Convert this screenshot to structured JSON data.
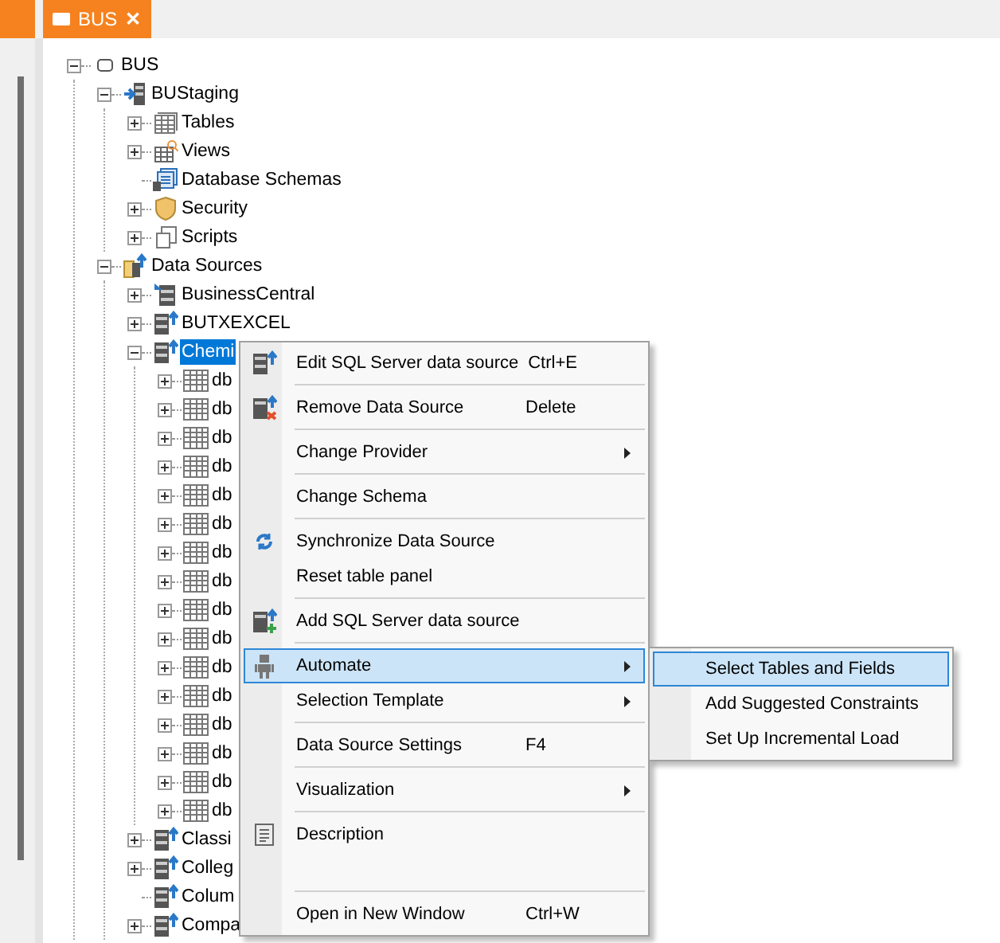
{
  "tabs": [
    {
      "label": "BUS",
      "close_glyph": "✕",
      "selected": true
    }
  ],
  "tree": [
    {
      "label": "BUS",
      "kind": "model",
      "expanded": true,
      "selected": false,
      "children": [
        {
          "label": "BUStaging",
          "kind": "staging",
          "expanded": true,
          "selected": false,
          "children": [
            {
              "label": "Tables",
              "kind": "tables",
              "expanded": false,
              "selected": false
            },
            {
              "label": "Views",
              "kind": "views",
              "expanded": false,
              "selected": false
            },
            {
              "label": "Database Schemas",
              "kind": "schemas",
              "selected": false
            },
            {
              "label": "Security",
              "kind": "security",
              "expanded": false,
              "selected": false
            },
            {
              "label": "Scripts",
              "kind": "scripts",
              "expanded": false,
              "selected": false
            }
          ]
        },
        {
          "label": "Data Sources",
          "kind": "datasources",
          "expanded": true,
          "selected": false,
          "children": [
            {
              "label": "BusinessCentral",
              "kind": "source-in",
              "expanded": false,
              "selected": false
            },
            {
              "label": "BUTXEXCEL",
              "kind": "source",
              "expanded": false,
              "selected": false
            },
            {
              "label": "Chemi",
              "kind": "source",
              "expanded": true,
              "selected": true,
              "children": [
                {
                  "label": "db",
                  "kind": "table",
                  "expanded": false,
                  "selected": false
                },
                {
                  "label": "db",
                  "kind": "table",
                  "expanded": false,
                  "selected": false
                },
                {
                  "label": "db",
                  "kind": "table",
                  "expanded": false,
                  "selected": false
                },
                {
                  "label": "db",
                  "kind": "table",
                  "expanded": false,
                  "selected": false
                },
                {
                  "label": "db",
                  "kind": "table",
                  "expanded": false,
                  "selected": false
                },
                {
                  "label": "db",
                  "kind": "table",
                  "expanded": false,
                  "selected": false
                },
                {
                  "label": "db",
                  "kind": "table",
                  "expanded": false,
                  "selected": false
                },
                {
                  "label": "db",
                  "kind": "table",
                  "expanded": false,
                  "selected": false
                },
                {
                  "label": "db",
                  "kind": "table",
                  "expanded": false,
                  "selected": false
                },
                {
                  "label": "db",
                  "kind": "table",
                  "expanded": false,
                  "selected": false
                },
                {
                  "label": "db",
                  "kind": "table",
                  "expanded": false,
                  "selected": false
                },
                {
                  "label": "db",
                  "kind": "table",
                  "expanded": false,
                  "selected": false
                },
                {
                  "label": "db",
                  "kind": "table",
                  "expanded": false,
                  "selected": false
                },
                {
                  "label": "db",
                  "kind": "table",
                  "expanded": false,
                  "selected": false
                },
                {
                  "label": "db",
                  "kind": "table",
                  "expanded": false,
                  "selected": false
                },
                {
                  "label": "db",
                  "kind": "table",
                  "expanded": false,
                  "selected": false
                }
              ]
            },
            {
              "label": "Classi",
              "kind": "source",
              "expanded": false,
              "selected": false
            },
            {
              "label": "Colleg",
              "kind": "source",
              "expanded": false,
              "selected": false
            },
            {
              "label": "Colum",
              "kind": "source",
              "selected": false
            },
            {
              "label": "Compa",
              "kind": "source",
              "expanded": false,
              "selected": false
            }
          ]
        }
      ]
    }
  ],
  "context_menu": [
    {
      "kind": "item",
      "label": "Edit SQL Server data source",
      "shortcut": "Ctrl+E",
      "submenu": false,
      "selected": false
    },
    {
      "kind": "separator"
    },
    {
      "kind": "item",
      "label": "Remove Data Source",
      "shortcut": "Delete",
      "submenu": false,
      "selected": false
    },
    {
      "kind": "separator"
    },
    {
      "kind": "item",
      "label": "Change Provider",
      "submenu": true,
      "selected": false
    },
    {
      "kind": "separator"
    },
    {
      "kind": "item",
      "label": "Change Schema",
      "submenu": false,
      "selected": false
    },
    {
      "kind": "separator"
    },
    {
      "kind": "item",
      "label": "Synchronize Data Source",
      "submenu": false,
      "selected": false
    },
    {
      "kind": "item",
      "label": "Reset table panel",
      "submenu": false,
      "selected": false
    },
    {
      "kind": "separator"
    },
    {
      "kind": "item",
      "label": "Add SQL Server data source",
      "submenu": false,
      "selected": false
    },
    {
      "kind": "separator"
    },
    {
      "kind": "item",
      "label": "Automate",
      "submenu": true,
      "selected": true
    },
    {
      "kind": "item",
      "label": "Selection Template",
      "submenu": true,
      "selected": false
    },
    {
      "kind": "separator"
    },
    {
      "kind": "item",
      "label": "Data Source Settings",
      "shortcut": "F4",
      "submenu": false,
      "selected": false
    },
    {
      "kind": "separator"
    },
    {
      "kind": "item",
      "label": "Visualization",
      "submenu": true,
      "selected": false
    },
    {
      "kind": "separator"
    },
    {
      "kind": "item",
      "label": "Description",
      "submenu": false,
      "selected": false
    },
    {
      "kind": "blank"
    },
    {
      "kind": "separator"
    },
    {
      "kind": "item",
      "label": "Open in New Window",
      "shortcut": "Ctrl+W",
      "submenu": false,
      "selected": false
    }
  ],
  "submenu": [
    {
      "label": "Select Tables and Fields",
      "selected": true
    },
    {
      "label": "Add Suggested Constraints",
      "selected": false
    },
    {
      "label": "Set Up Incremental Load",
      "selected": false
    }
  ]
}
